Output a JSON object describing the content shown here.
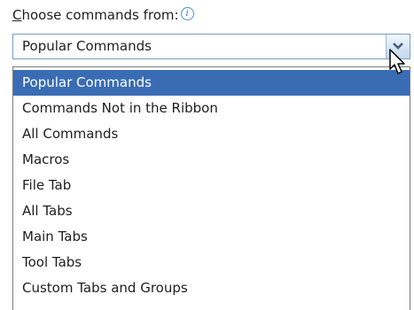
{
  "label": {
    "mnemonic": "C",
    "rest": "hoose commands from:",
    "info_icon": "info-icon",
    "info_glyph": "i"
  },
  "combo": {
    "selected_value": "Popular Commands",
    "button_icon": "chevron-down-icon"
  },
  "dropdown": {
    "options": [
      "Popular Commands",
      "Commands Not in the Ribbon",
      "All Commands",
      "Macros",
      "File Tab",
      "All Tabs",
      "Main Tabs",
      "Tool Tabs",
      "Custom Tabs and Groups"
    ],
    "highlighted_index": 0
  },
  "colors": {
    "highlight": "#3a6cb4",
    "highlight_text": "#ffffff",
    "combo_border": "#7a9ebf",
    "info_icon": "#2a6fcf"
  }
}
